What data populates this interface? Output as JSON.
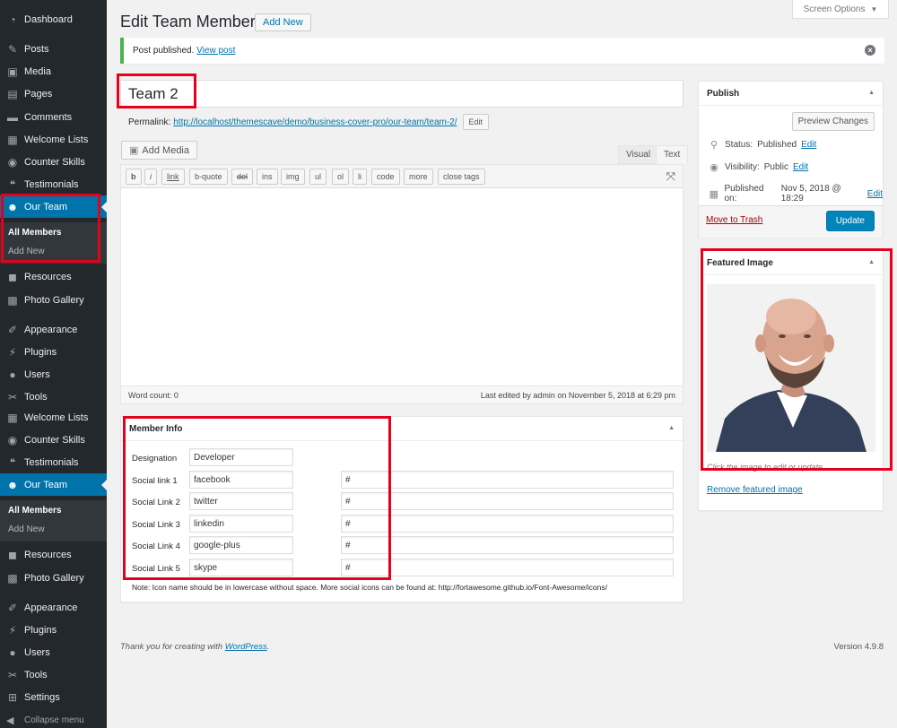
{
  "sidebar": {
    "items": [
      {
        "label": "Dashboard",
        "icon": "dashboard-icon"
      },
      {
        "label": "Posts",
        "icon": "pin-icon"
      },
      {
        "label": "Media",
        "icon": "media-icon"
      },
      {
        "label": "Pages",
        "icon": "pages-icon"
      },
      {
        "label": "Comments",
        "icon": "comments-icon"
      },
      {
        "label": "Welcome Lists",
        "icon": "list-icon"
      },
      {
        "label": "Counter Skills",
        "icon": "counter-icon"
      },
      {
        "label": "Testimonials",
        "icon": "quote-icon"
      },
      {
        "label": "Our Team",
        "icon": "team-icon"
      },
      {
        "label": "Resources",
        "icon": "resources-icon"
      },
      {
        "label": "Photo Gallery",
        "icon": "gallery-icon"
      },
      {
        "label": "Appearance",
        "icon": "brush-icon"
      },
      {
        "label": "Plugins",
        "icon": "plugin-icon"
      },
      {
        "label": "Users",
        "icon": "user-icon"
      },
      {
        "label": "Tools",
        "icon": "wrench-icon"
      },
      {
        "label": "Welcome Lists",
        "icon": "list-icon"
      },
      {
        "label": "Counter Skills",
        "icon": "counter-icon"
      },
      {
        "label": "Testimonials",
        "icon": "quote-icon"
      },
      {
        "label": "Our Team",
        "icon": "team-icon"
      },
      {
        "label": "Resources",
        "icon": "resources-icon"
      },
      {
        "label": "Photo Gallery",
        "icon": "gallery-icon"
      },
      {
        "label": "Appearance",
        "icon": "brush-icon"
      },
      {
        "label": "Plugins",
        "icon": "plugin-icon"
      },
      {
        "label": "Users",
        "icon": "user-icon"
      },
      {
        "label": "Tools",
        "icon": "wrench-icon"
      },
      {
        "label": "Settings",
        "icon": "settings-icon"
      }
    ],
    "submenu_1": {
      "all_members": "All Members",
      "add_new": "Add New"
    },
    "submenu_2": {
      "all_members": "All Members",
      "add_new": "Add New"
    },
    "collapse_label": "Collapse menu",
    "active_color": "#0073aa"
  },
  "header": {
    "title": "Edit Team Member",
    "add_new": "Add New",
    "screen_options": "Screen Options"
  },
  "notice": {
    "text": "Post published.",
    "link": "View post"
  },
  "post": {
    "title": "Team 2",
    "permalink_label": "Permalink:",
    "permalink_url": "http://localhost/themescave/demo/business-cover-pro/our-team/team-2/",
    "edit_label": "Edit"
  },
  "editor": {
    "add_media": "Add Media",
    "tab_visual": "Visual",
    "tab_text": "Text",
    "quicktags": [
      "b",
      "i",
      "link",
      "b-quote",
      "del",
      "ins",
      "img",
      "ul",
      "ol",
      "li",
      "code",
      "more",
      "close tags"
    ],
    "word_count": "Word count: 0",
    "last_edited": "Last edited by admin on November 5, 2018 at 6:29 pm"
  },
  "member_info": {
    "title": "Member Info",
    "designation_label": "Designation",
    "designation_value": "Developer",
    "social": [
      {
        "label": "Social link 1",
        "icon": "facebook",
        "url": "#"
      },
      {
        "label": "Social Link 2",
        "icon": "twitter",
        "url": "#"
      },
      {
        "label": "Social Link 3",
        "icon": "linkedin",
        "url": "#"
      },
      {
        "label": "Social Link 4",
        "icon": "google-plus",
        "url": "#"
      },
      {
        "label": "Social Link 5",
        "icon": "skype",
        "url": "#"
      }
    ],
    "note": "Note: Icon name should be in lowercase without space. More social icons can be found at: http://fortawesome.github.io/Font-Awesome/icons/"
  },
  "publish": {
    "title": "Publish",
    "preview_changes": "Preview Changes",
    "status_label": "Status:",
    "status_value": "Published",
    "visibility_label": "Visibility:",
    "visibility_value": "Public",
    "published_label": "Published on:",
    "published_value": "Nov 5, 2018 @ 18:29",
    "edit": "Edit",
    "move_to_trash": "Move to Trash",
    "update": "Update"
  },
  "featured_image": {
    "title": "Featured Image",
    "hint": "Click the image to edit or update",
    "remove": "Remove featured image"
  },
  "footer": {
    "thanks_prefix": "Thank you for creating with",
    "thanks_link": "WordPress",
    "version": "Version 4.9.8"
  }
}
